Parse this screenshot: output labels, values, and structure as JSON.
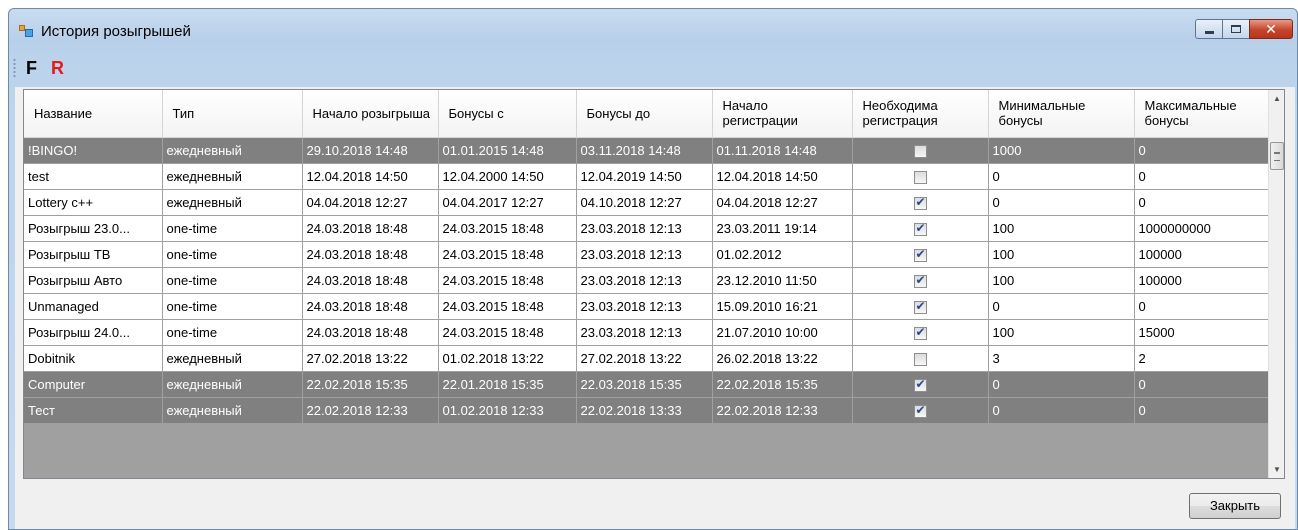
{
  "window": {
    "title": "История розыгрышей",
    "controls": {
      "minimize": "minimize-icon",
      "maximize": "maximize-icon",
      "close": "close-icon"
    }
  },
  "toolbar": {
    "f_label": "F",
    "r_label": "R"
  },
  "grid": {
    "columns": [
      "Название",
      "Тип",
      "Начало розыгрыша",
      "Бонусы с",
      "Бонусы до",
      "Начало регистрации",
      "Необходима регистрация",
      "Минимальные бонусы",
      "Максимальные бонусы"
    ],
    "rows": [
      {
        "name": "!BINGO!",
        "type": "ежедневный",
        "start": "29.10.2018 14:48",
        "bonus_from": "01.01.2015 14:48",
        "bonus_to": "03.11.2018 14:48",
        "reg_start": "01.11.2018 14:48",
        "reg_required": false,
        "min_bonus": "1000",
        "max_bonus": "0",
        "highlighted": true
      },
      {
        "name": "test",
        "type": "ежедневный",
        "start": "12.04.2018 14:50",
        "bonus_from": "12.04.2000 14:50",
        "bonus_to": "12.04.2019 14:50",
        "reg_start": "12.04.2018 14:50",
        "reg_required": false,
        "min_bonus": "0",
        "max_bonus": "0",
        "highlighted": false
      },
      {
        "name": "Lottery c++",
        "type": "ежедневный",
        "start": "04.04.2018 12:27",
        "bonus_from": "04.04.2017 12:27",
        "bonus_to": "04.10.2018 12:27",
        "reg_start": "04.04.2018 12:27",
        "reg_required": true,
        "min_bonus": "0",
        "max_bonus": "0",
        "highlighted": false
      },
      {
        "name": "Розыгрыш 23.0...",
        "type": "one-time",
        "start": "24.03.2018 18:48",
        "bonus_from": "24.03.2015 18:48",
        "bonus_to": "23.03.2018 12:13",
        "reg_start": "23.03.2011 19:14",
        "reg_required": true,
        "min_bonus": "100",
        "max_bonus": "1000000000",
        "highlighted": false
      },
      {
        "name": "Розыгрыш ТВ",
        "type": "one-time",
        "start": "24.03.2018 18:48",
        "bonus_from": "24.03.2015 18:48",
        "bonus_to": "23.03.2018 12:13",
        "reg_start": "01.02.2012",
        "reg_required": true,
        "min_bonus": "100",
        "max_bonus": "100000",
        "highlighted": false
      },
      {
        "name": "Розыгрыш Авто",
        "type": "one-time",
        "start": "24.03.2018 18:48",
        "bonus_from": "24.03.2015 18:48",
        "bonus_to": "23.03.2018 12:13",
        "reg_start": "23.12.2010 11:50",
        "reg_required": true,
        "min_bonus": "100",
        "max_bonus": "100000",
        "highlighted": false
      },
      {
        "name": "Unmanaged",
        "type": "one-time",
        "start": "24.03.2018 18:48",
        "bonus_from": "24.03.2015 18:48",
        "bonus_to": "23.03.2018 12:13",
        "reg_start": "15.09.2010 16:21",
        "reg_required": true,
        "min_bonus": "0",
        "max_bonus": "0",
        "highlighted": false
      },
      {
        "name": "Розыгрыш 24.0...",
        "type": "one-time",
        "start": "24.03.2018 18:48",
        "bonus_from": "24.03.2015 18:48",
        "bonus_to": "23.03.2018 12:13",
        "reg_start": "21.07.2010 10:00",
        "reg_required": true,
        "min_bonus": "100",
        "max_bonus": "15000",
        "highlighted": false
      },
      {
        "name": "Dobitnik",
        "type": "ежедневный",
        "start": "27.02.2018 13:22",
        "bonus_from": "01.02.2018 13:22",
        "bonus_to": "27.02.2018 13:22",
        "reg_start": "26.02.2018 13:22",
        "reg_required": false,
        "min_bonus": "3",
        "max_bonus": "2",
        "highlighted": false
      },
      {
        "name": "Computer",
        "type": "ежедневный",
        "start": "22.02.2018 15:35",
        "bonus_from": "22.01.2018 15:35",
        "bonus_to": "22.03.2018 15:35",
        "reg_start": "22.02.2018 15:35",
        "reg_required": true,
        "min_bonus": "0",
        "max_bonus": "0",
        "highlighted": true
      },
      {
        "name": "Тест",
        "type": "ежедневный",
        "start": "22.02.2018 12:33",
        "bonus_from": "01.02.2018 12:33",
        "bonus_to": "22.02.2018 13:33",
        "reg_start": "22.02.2018 12:33",
        "reg_required": true,
        "min_bonus": "0",
        "max_bonus": "0",
        "highlighted": true
      }
    ]
  },
  "footer": {
    "close_label": "Закрыть"
  },
  "colors": {
    "highlight_row": "#808080",
    "title_bar": "#bcd3ec",
    "close_button": "#c4452c",
    "r_button": "#e21a1a"
  }
}
